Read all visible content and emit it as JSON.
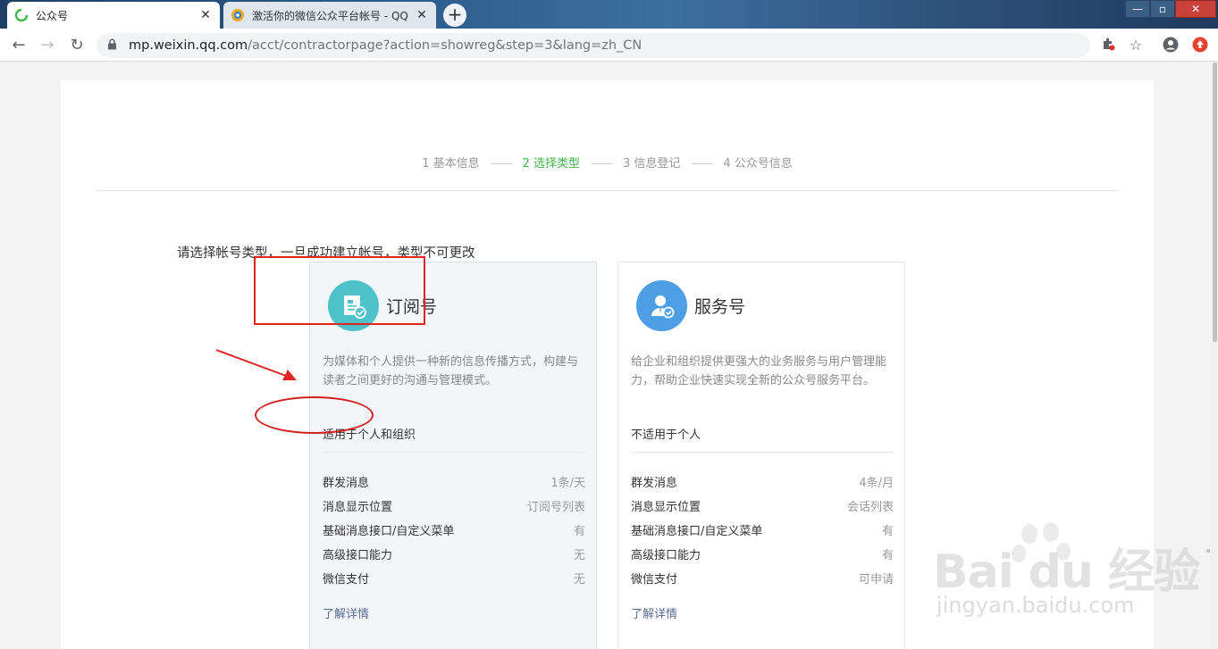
{
  "browser": {
    "tabs": [
      {
        "label": "公众号",
        "close": "✕"
      },
      {
        "label": "激活你的微信公众平台帐号 - QQ",
        "close": "✕"
      }
    ],
    "new_tab": "+",
    "url_host": "mp.weixin.qq.com",
    "url_path": "/acct/contractorpage?action=showreg&step=3&lang=zh_CN"
  },
  "steps": [
    {
      "label": "1 基本信息",
      "state": "done"
    },
    {
      "label": "2 选择类型",
      "state": "current"
    },
    {
      "label": "3 信息登记",
      "state": "todo"
    },
    {
      "label": "4 公众号信息",
      "state": "todo"
    }
  ],
  "step_separator": "——",
  "prompt": "请选择帐号类型，一旦成功建立帐号，类型不可更改",
  "cards": {
    "subscription": {
      "name": "订阅号",
      "desc": "为媒体和个人提供一种新的信息传播方式，构建与读者之间更好的沟通与管理模式。",
      "fit": "适用于个人和组织",
      "features": [
        {
          "k": "群发消息",
          "v": "1条/天"
        },
        {
          "k": "消息显示位置",
          "v": "订阅号列表"
        },
        {
          "k": "基础消息接口/自定义菜单",
          "v": "有"
        },
        {
          "k": "高级接口能力",
          "v": "无"
        },
        {
          "k": "微信支付",
          "v": "无"
        }
      ],
      "more": "了解详情",
      "color": "#4fc1c9"
    },
    "service": {
      "name": "服务号",
      "desc": "给企业和组织提供更强大的业务服务与用户管理能力，帮助企业快速实现全新的公众号服务平台。",
      "fit": "不适用于个人",
      "features": [
        {
          "k": "群发消息",
          "v": "4条/月"
        },
        {
          "k": "消息显示位置",
          "v": "会话列表"
        },
        {
          "k": "基础消息接口/自定义菜单",
          "v": "有"
        },
        {
          "k": "高级接口能力",
          "v": "有"
        },
        {
          "k": "微信支付",
          "v": "可申请"
        }
      ],
      "more": "了解详情",
      "color": "#4d9ee5"
    }
  },
  "watermark": {
    "brand": "Bai du 经验",
    "site": "jingyan.baidu.com"
  },
  "colors": {
    "accent": "#44b549",
    "annotation": "#e02424",
    "link": "#576b95"
  }
}
